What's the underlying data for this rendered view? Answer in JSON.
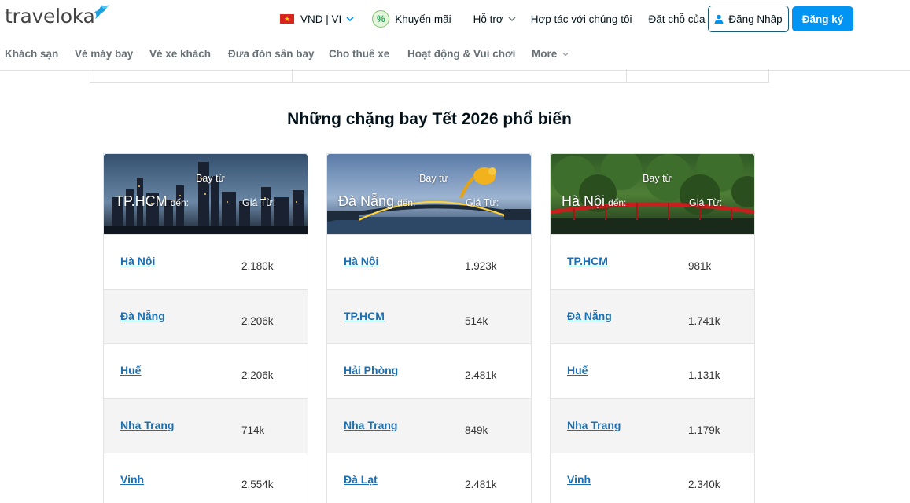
{
  "brand": {
    "name": "traveloka",
    "accent": "#0194f3",
    "bird_color": "#1ba0e2"
  },
  "header": {
    "currency": "VND | VI",
    "promo": "Khuyến mãi",
    "support": "Hỗ trợ",
    "partner": "Hợp tác với chúng tôi",
    "bookings": "Đặt chỗ của tôi",
    "login": "Đăng Nhập",
    "register": "Đăng ký"
  },
  "products": [
    {
      "label": "Khách sạn"
    },
    {
      "label": "Vé máy bay"
    },
    {
      "label": "Vé xe khách"
    },
    {
      "label": "Đưa đón sân bay"
    },
    {
      "label": "Cho thuê xe"
    },
    {
      "label": "Hoạt động & Vui chơi"
    },
    {
      "label": "More"
    }
  ],
  "section": {
    "title": "Những chặng bay Tết 2026 phổ biến"
  },
  "cards": [
    {
      "from_label": "Bay từ",
      "origin": "TP.HCM",
      "to_label": "đến:",
      "price_label": "Giá Từ:",
      "routes": [
        {
          "dest": "Hà Nội",
          "price": "2.180k"
        },
        {
          "dest": "Đà Nẵng",
          "price": "2.206k"
        },
        {
          "dest": "Huế",
          "price": "2.206k"
        },
        {
          "dest": "Nha Trang",
          "price": "714k"
        },
        {
          "dest": "Vinh",
          "price": "2.554k"
        }
      ]
    },
    {
      "from_label": "Bay từ",
      "origin": "Đà Nẵng",
      "to_label": "đến:",
      "price_label": "Giá Từ:",
      "routes": [
        {
          "dest": "Hà Nội",
          "price": "1.923k"
        },
        {
          "dest": "TP.HCM",
          "price": "514k"
        },
        {
          "dest": "Hải Phòng",
          "price": "2.481k"
        },
        {
          "dest": "Nha Trang",
          "price": "849k"
        },
        {
          "dest": "Đà Lạt",
          "price": "2.481k"
        }
      ]
    },
    {
      "from_label": "Bay từ",
      "origin": "Hà Nội",
      "to_label": "đến:",
      "price_label": "Giá Từ:",
      "routes": [
        {
          "dest": "TP.HCM",
          "price": "981k"
        },
        {
          "dest": "Đà Nẵng",
          "price": "1.741k"
        },
        {
          "dest": "Huế",
          "price": "1.131k"
        },
        {
          "dest": "Nha Trang",
          "price": "1.179k"
        },
        {
          "dest": "Vinh",
          "price": "2.340k"
        }
      ]
    }
  ]
}
